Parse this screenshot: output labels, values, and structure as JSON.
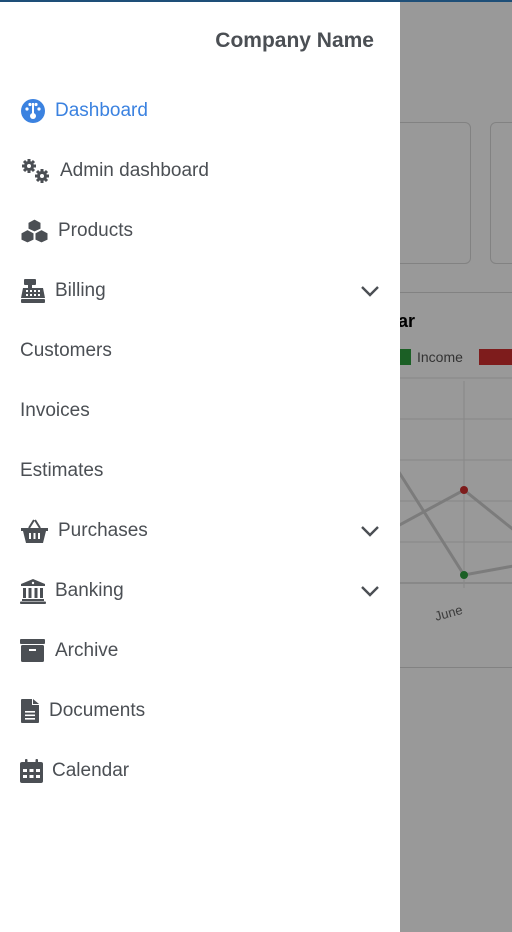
{
  "drawer": {
    "company_name": "Company Name",
    "items": [
      {
        "label": "Dashboard",
        "icon": "gauge-icon",
        "active": true
      },
      {
        "label": "Admin dashboard",
        "icon": "gears-icon"
      },
      {
        "label": "Products",
        "icon": "cubes-icon"
      },
      {
        "label": "Billing",
        "icon": "cash-register-icon",
        "expandable": true
      },
      {
        "label": "Customers"
      },
      {
        "label": "Invoices"
      },
      {
        "label": "Estimates"
      },
      {
        "label": "Purchases",
        "icon": "basket-icon",
        "expandable": true
      },
      {
        "label": "Banking",
        "icon": "bank-icon",
        "expandable": true
      },
      {
        "label": "Archive",
        "icon": "archive-box-icon"
      },
      {
        "label": "Documents",
        "icon": "document-icon"
      },
      {
        "label": "Calendar",
        "icon": "calendar-icon"
      }
    ]
  },
  "background": {
    "chart_title_fragment": "ear",
    "legend": [
      {
        "label": "Income",
        "color": "#2e9e3e"
      },
      {
        "label": "",
        "color": "#d32f2f"
      }
    ],
    "x_label_visible": "June"
  },
  "colors": {
    "accent": "#3b82e0",
    "text": "#4b4f54",
    "income": "#2e9e3e",
    "expense": "#d32f2f"
  }
}
